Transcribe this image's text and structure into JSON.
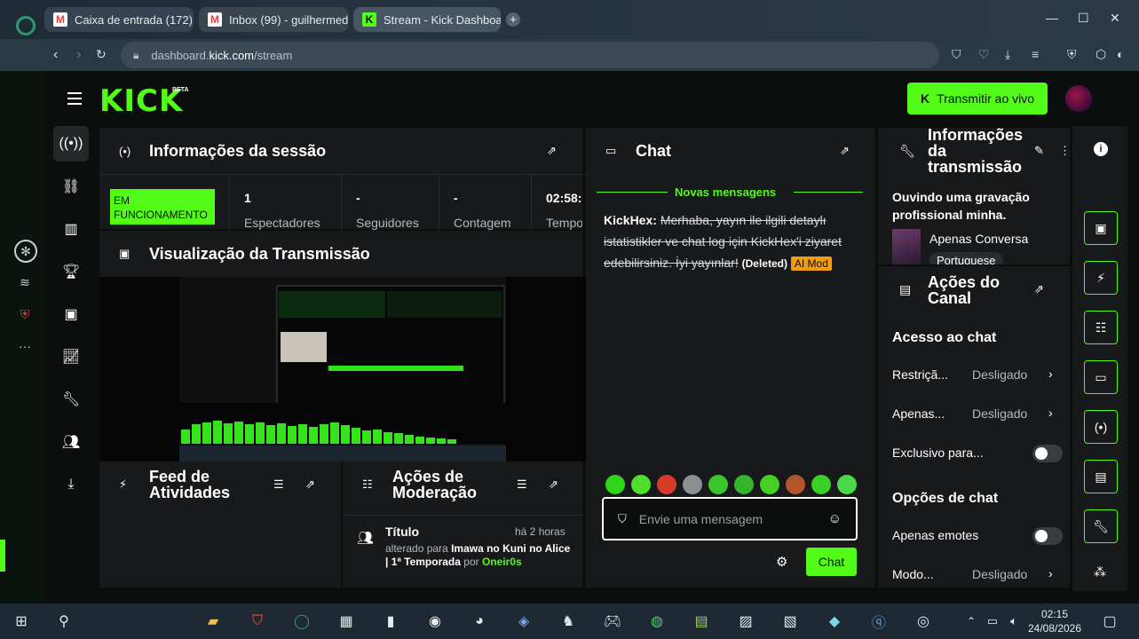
{
  "browser": {
    "tabs": [
      {
        "label": "Caixa de entrada (172)",
        "icon": "gmail-icon"
      },
      {
        "label": "Inbox (99) - guilhermed",
        "icon": "gmail-icon"
      },
      {
        "label": "Stream - Kick Dashboar",
        "icon": "kick-icon"
      }
    ],
    "new_tab": "+",
    "url_domain": "dashboard.",
    "url_host": "kick.com",
    "url_path": "/stream"
  },
  "header": {
    "logo": "KICK",
    "logo_badge": "BETA",
    "go_live_label": "Transmitir ao vivo"
  },
  "session": {
    "title": "Informações da sessão",
    "status": "EM FUNCIONAMENTO",
    "stats": [
      {
        "value": "1",
        "label": "Espectadores"
      },
      {
        "value": "-",
        "label": "Seguidores"
      },
      {
        "value": "-",
        "label": "Contagem"
      },
      {
        "value": "02:58:",
        "label": "Tempo"
      }
    ]
  },
  "preview": {
    "title": "Visualização da Transmissão"
  },
  "activity": {
    "title_line1": "Feed de",
    "title_line2": "Atividades"
  },
  "moderation": {
    "title_line1": "Ações de",
    "title_line2": "Moderação",
    "entry": {
      "title": "Título",
      "time": "há 2 horas",
      "prefix": "alterado para",
      "value": "Imawa no Kuni no Alice | 1ª Temporada",
      "by": "por",
      "user": "Oneir0s"
    }
  },
  "chat": {
    "title": "Chat",
    "new_messages": "Novas mensagens",
    "message": {
      "user": "KickHex:",
      "text": "Merhaba, yayın ile ilgili detaylı istatistikler ve chat log için KickHex'i ziyaret edebilirsiniz. İyi yayınlar!",
      "deleted": "(Deleted)",
      "badge": "AI Mod"
    },
    "placeholder": "Envie uma mensagem",
    "send_label": "Chat",
    "emotes": [
      "#2fd61a",
      "#4ee02a",
      "#d63b2a",
      "#8a8f94",
      "#38c82a",
      "#35b52c",
      "#46d024",
      "#b4542a",
      "#3bcf2a",
      "#48d84a"
    ]
  },
  "stream_info": {
    "title_line1": "Informações",
    "title_line2": "da",
    "title_line3": "transmissão",
    "stream_title": "Ouvindo uma gravação profissional minha.",
    "category": "Apenas Conversa",
    "language": "Portuguese"
  },
  "channel_actions": {
    "title_line1": "Ações do",
    "title_line2": "Canal",
    "chat_access_heading": "Acesso ao chat",
    "restriction_label": "Restriçã...",
    "restriction_value": "Desligado",
    "only_label": "Apenas...",
    "only_value": "Desligado",
    "exclusive_label": "Exclusivo para...",
    "chat_options_heading": "Opções de chat",
    "emotes_only_label": "Apenas emotes",
    "mode_label": "Modo...",
    "mode_value": "Desligado"
  },
  "taskbar": {
    "time": "02:15",
    "date": "24/08/2026"
  },
  "colors": {
    "kick_green": "#53fc18",
    "panel": "#18191b",
    "ai_mod": "#f29c11"
  }
}
